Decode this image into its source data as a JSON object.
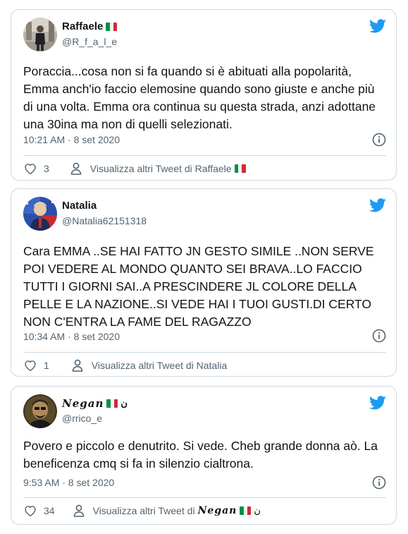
{
  "tweets": [
    {
      "name": "Raffaele",
      "handle": "@R_f_a_l_e",
      "text": "Poraccia...cosa non si fa quando si è abituati alla popolarità, Emma anch'io faccio elemosine quando sono giuste e anche più di una volta. Emma ora continua su questa strada, anzi adottane una 30ina ma non di quelli selezionati.",
      "time": "10:21 AM · 8 set 2020",
      "likes": "3",
      "more_label": "Visualizza altri Tweet di Raffaele"
    },
    {
      "name": "Natalia",
      "handle": "@Natalia62151318",
      "text": "Cara EMMA ..SE HAI FATTO JN GESTO SIMILE ..NON SERVE POI VEDERE AL MONDO QUANTO SEI BRAVA..LO FACCIO TUTTI I GIORNI SAI..A PRESCINDERE JL COLORE DELLA PELLE E LA NAZIONE..SI VEDE HAI I TUOI GUSTI.DI CERTO NON C'ENTRA LA FAME DEL RAGAZZO",
      "time": "10:34 AM · 8 set 2020",
      "likes": "1",
      "more_label": "Visualizza altri Tweet di Natalia"
    },
    {
      "name": "𝑵𝒆𝒈𝒂𝒏",
      "name_suffix": "ن",
      "handle": "@rrico_e",
      "text": "Povero e piccolo e denutrito. Si vede. Cheb grande donna aò. La beneficenza cmq si fa in silenzio cialtrona.",
      "time": "9:53 AM · 8 set 2020",
      "likes": "34",
      "more_label": "Visualizza altri Tweet di",
      "more_name": "𝑵𝒆𝒈𝒂𝒏",
      "more_suffix": "ن"
    }
  ],
  "icons": {
    "brand": "twitter-bird-icon",
    "like": "heart-icon",
    "profile": "person-icon",
    "info": "info-icon",
    "flag": "italy-flag-icon"
  },
  "colors": {
    "twitter_blue": "#1d9bf0",
    "secondary_text": "#536471",
    "border": "#cfd9de"
  }
}
